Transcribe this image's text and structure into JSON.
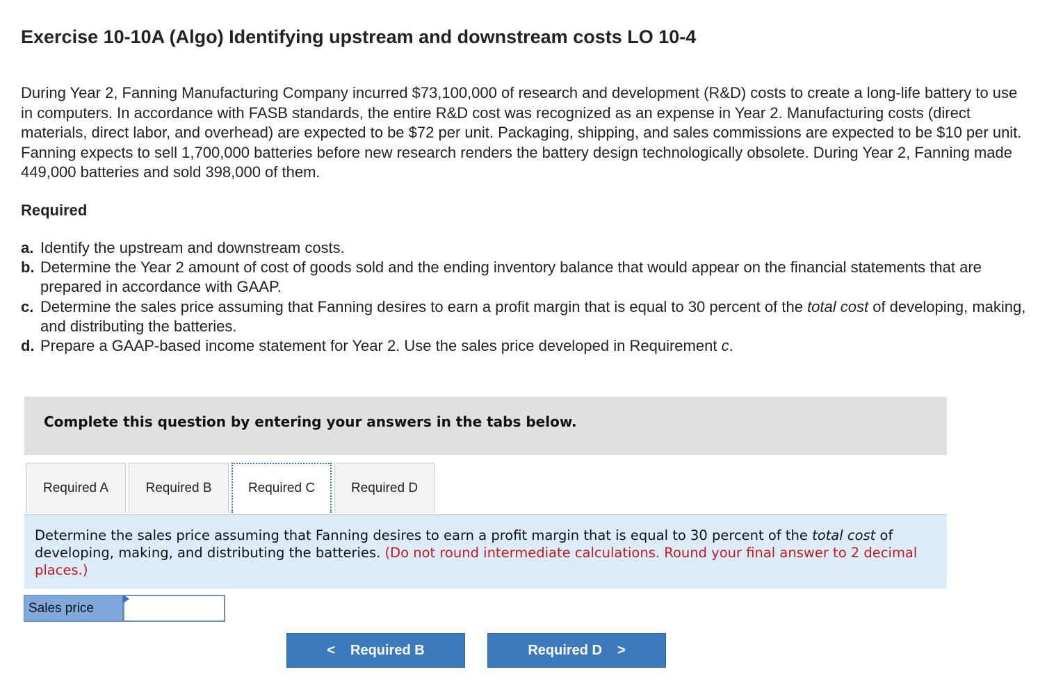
{
  "title": "Exercise 10-10A (Algo) Identifying upstream and downstream costs LO 10-4",
  "intro": "During Year 2, Fanning Manufacturing Company incurred $73,100,000 of research and development (R&D) costs to create a long-life battery to use in computers. In accordance with FASB standards, the entire R&D cost was recognized as an expense in Year 2. Manufacturing costs (direct materials, direct labor, and overhead) are expected to be $72 per unit. Packaging, shipping, and sales commissions are expected to be $10 per unit. Fanning expects to sell 1,700,000 batteries before new research renders the battery design technologically obsolete. During Year 2, Fanning made 449,000 batteries and sold 398,000 of them.",
  "required_heading": "Required",
  "requirements": [
    {
      "letter": "a.",
      "text": "Identify the upstream and downstream costs."
    },
    {
      "letter": "b.",
      "text": "Determine the Year 2 amount of cost of goods sold and the ending inventory balance that would appear on the financial statements that are prepared in accordance with GAAP."
    },
    {
      "letter": "c.",
      "pre": "Determine the sales price assuming that Fanning desires to earn a profit margin that is equal to 30 percent of the ",
      "em": "total cost",
      "post": " of developing, making, and distributing the batteries."
    },
    {
      "letter": "d.",
      "pre": "Prepare a GAAP-based income statement for Year 2. Use the sales price developed in Requirement ",
      "em": "c",
      "post": "."
    }
  ],
  "banner": "Complete this question by entering your answers in the tabs below.",
  "tabs": [
    {
      "label": "Required A",
      "active": false
    },
    {
      "label": "Required B",
      "active": false
    },
    {
      "label": "Required C",
      "active": true
    },
    {
      "label": "Required D",
      "active": false
    }
  ],
  "instruction": {
    "pre": "Determine the sales price assuming that Fanning desires to earn a profit margin that is equal to 30 percent of the ",
    "em": "total cost",
    "post": " of developing, making, and distributing the batteries. ",
    "note": "(Do not round intermediate calculations. Round your final answer to 2 decimal places.)"
  },
  "answer": {
    "label": "Sales price",
    "value": ""
  },
  "nav": {
    "prev_label": "Required B",
    "next_label": "Required D",
    "prev_icon": "chevron-left-icon",
    "next_icon": "chevron-right-icon"
  },
  "colors": {
    "banner_bg": "#e0e0e0",
    "instruction_bg": "#dcebf8",
    "note_red": "#c0191e",
    "button_blue": "#3d79bd",
    "label_blue": "#7fa9dc"
  }
}
